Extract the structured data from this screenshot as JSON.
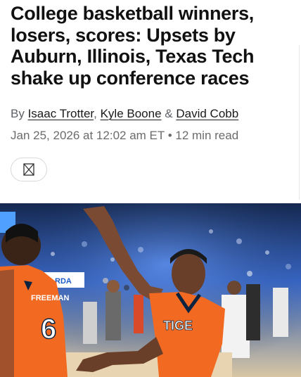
{
  "article": {
    "headline": "College basketball winners, losers, scores: Upsets by Auburn, Illinois, Texas Tech shake up conference races",
    "byline": {
      "prefix": "By",
      "authors": [
        "Isaac Trotter",
        "Kyle Boone",
        "David Cobb"
      ],
      "comma": ",",
      "ampersand": "&"
    },
    "date": "Jan 25, 2026 at 12:02 am ET",
    "separator": "•",
    "read_time": "12 min read"
  },
  "share": {
    "icon": "share-icon"
  },
  "hero_image": {
    "jersey_left_name": "FREEMAN",
    "jersey_left_number": "6",
    "jersey_right_text": "TIGE",
    "ribbon_text": "RDA",
    "colors": {
      "auburn_orange": "#f26a21",
      "navy": "#0c2340",
      "court": "#e8d4b0"
    }
  }
}
